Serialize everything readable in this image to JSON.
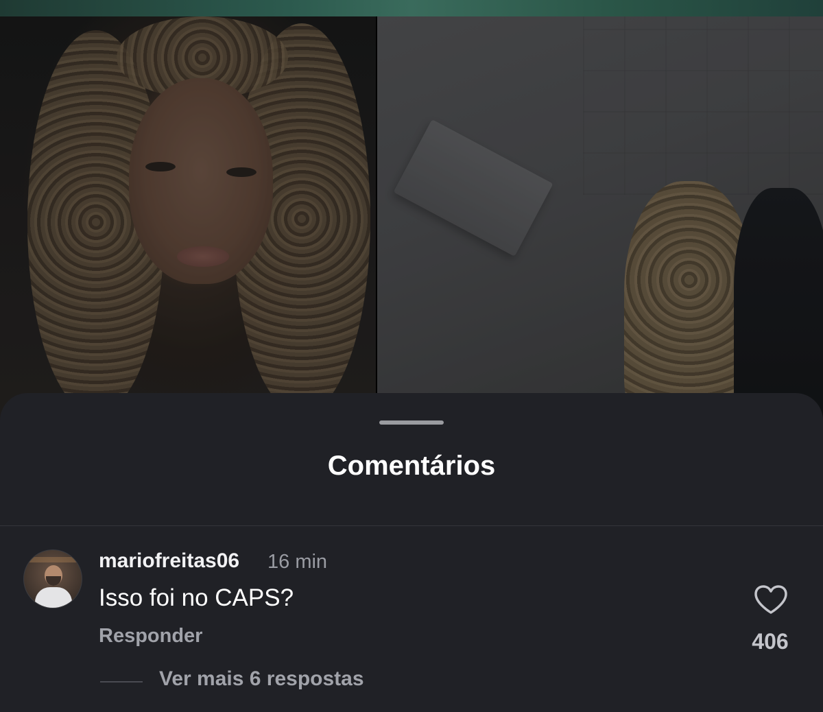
{
  "sheet": {
    "title": "Comentários"
  },
  "comment": {
    "username": "mariofreitas06",
    "time": "16 min",
    "text": "Isso foi no CAPS?",
    "reply_label": "Responder",
    "likes": "406",
    "more_replies": "Ver mais 6 respostas"
  },
  "icons": {
    "like": "heart-outline-icon"
  },
  "colors": {
    "sheet_background": "#202126",
    "primary_text": "#ffffff",
    "secondary_text": "#a1a3aa"
  }
}
